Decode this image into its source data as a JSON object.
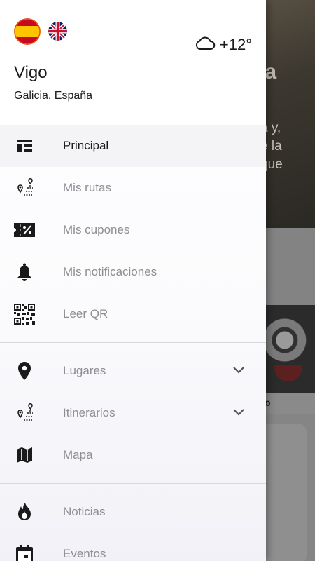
{
  "background": {
    "hero_title": "la",
    "hero_text_lines": [
      "a y,",
      "e la",
      "que"
    ],
    "card_label": "o"
  },
  "header": {
    "flags": [
      {
        "name": "spain-flag-icon",
        "lang": "es"
      },
      {
        "name": "uk-flag-icon",
        "lang": "en"
      }
    ],
    "weather": {
      "icon": "cloud-icon",
      "temperature": "+12°"
    },
    "city": "Vigo",
    "region": "Galicia, España"
  },
  "menu": {
    "section1": [
      {
        "label": "Principal",
        "icon": "dashboard-icon",
        "active": true
      },
      {
        "label": "Mis rutas",
        "icon": "route-icon"
      },
      {
        "label": "Mis cupones",
        "icon": "coupon-icon"
      },
      {
        "label": "Mis notificaciones",
        "icon": "bell-icon"
      },
      {
        "label": "Leer QR",
        "icon": "qr-code-icon"
      }
    ],
    "section2": [
      {
        "label": "Lugares",
        "icon": "map-pin-icon",
        "expandable": true
      },
      {
        "label": "Itinerarios",
        "icon": "route-icon",
        "expandable": true
      },
      {
        "label": "Mapa",
        "icon": "map-icon"
      }
    ],
    "section3": [
      {
        "label": "Noticias",
        "icon": "fire-icon"
      },
      {
        "label": "Eventos",
        "icon": "calendar-icon"
      }
    ]
  },
  "colors": {
    "active_text": "#1a1a1a",
    "inactive_text": "#8e8e93",
    "spain_red": "#c60b1e",
    "spain_yellow": "#ffc400",
    "uk_blue": "#012169"
  }
}
